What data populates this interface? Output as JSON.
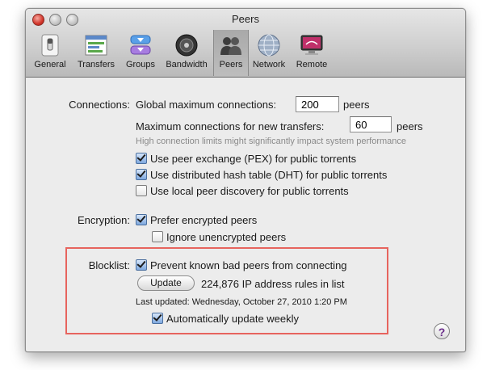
{
  "window": {
    "title": "Peers"
  },
  "toolbar": {
    "items": [
      {
        "label": "General",
        "icon": "switch-icon"
      },
      {
        "label": "Transfers",
        "icon": "transfers-icon"
      },
      {
        "label": "Groups",
        "icon": "groups-icon"
      },
      {
        "label": "Bandwidth",
        "icon": "speaker-icon"
      },
      {
        "label": "Peers",
        "icon": "peers-icon",
        "selected": true
      },
      {
        "label": "Network",
        "icon": "globe-icon"
      },
      {
        "label": "Remote",
        "icon": "monitor-icon"
      }
    ]
  },
  "connections": {
    "section_label": "Connections:",
    "global_label": "Global maximum connections:",
    "global_value": "200",
    "global_unit": "peers",
    "per_transfer_label": "Maximum connections for new transfers:",
    "per_transfer_value": "60",
    "per_transfer_unit": "peers",
    "hint": "High connection limits might significantly impact system performance",
    "pex": {
      "label": "Use peer exchange (PEX) for public torrents",
      "checked": true
    },
    "dht": {
      "label": "Use distributed hash table (DHT) for public torrents",
      "checked": true
    },
    "lpd": {
      "label": "Use local peer discovery for public torrents",
      "checked": false
    }
  },
  "encryption": {
    "section_label": "Encryption:",
    "prefer": {
      "label": "Prefer encrypted peers",
      "checked": true
    },
    "ignore": {
      "label": "Ignore unencrypted peers",
      "checked": false
    }
  },
  "blocklist": {
    "section_label": "Blocklist:",
    "prevent": {
      "label": "Prevent known bad peers from connecting",
      "checked": true
    },
    "update_button": "Update",
    "rules_text": "224,876 IP address rules in list",
    "last_updated": "Last updated: Wednesday, October 27, 2010 1:20 PM",
    "auto_update": {
      "label": "Automatically update weekly",
      "checked": true
    }
  },
  "help": {
    "label": "?"
  },
  "colors": {
    "highlight": "#e7645e",
    "accent": "#7ea8df"
  }
}
